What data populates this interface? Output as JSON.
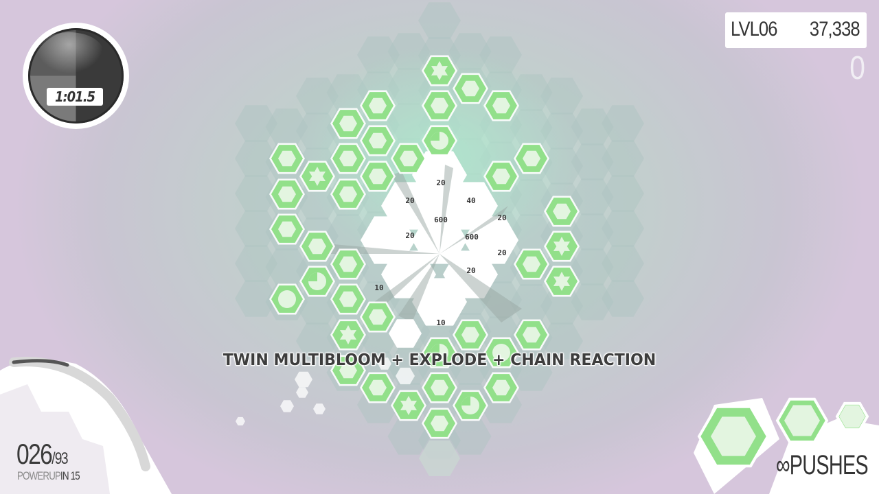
{
  "hud": {
    "timer": "1:01.5",
    "level": "LVL06",
    "score": "37,338",
    "combo_count": "0",
    "combo_banner": "TWIN MULTIBLOOM + EXPLODE + CHAIN REACTION",
    "progress_current": "026",
    "progress_separator": "/",
    "progress_total": "93",
    "powerup_label": "POWERUP",
    "powerup_in": "IN 15",
    "pushes_infinity": "∞",
    "pushes_label": "PUSHES"
  },
  "score_popups": [
    "20",
    "20",
    "40",
    "20",
    "600",
    "600",
    "20",
    "20",
    "20",
    "10",
    "10"
  ],
  "colors": {
    "tile_green": "#92e08a",
    "tile_inner": "#e3f5e0",
    "board_shadow": "#aec4c0",
    "explosion": "#ffffff",
    "text_dark": "#333333"
  },
  "icons": {
    "tile_types": [
      "hex-tile",
      "star-tile",
      "pie-tile",
      "circle-tile"
    ],
    "pushes_icon": "infinity-icon"
  },
  "queue": [
    "hex-tile",
    "hex-tile",
    "hex-tile"
  ]
}
